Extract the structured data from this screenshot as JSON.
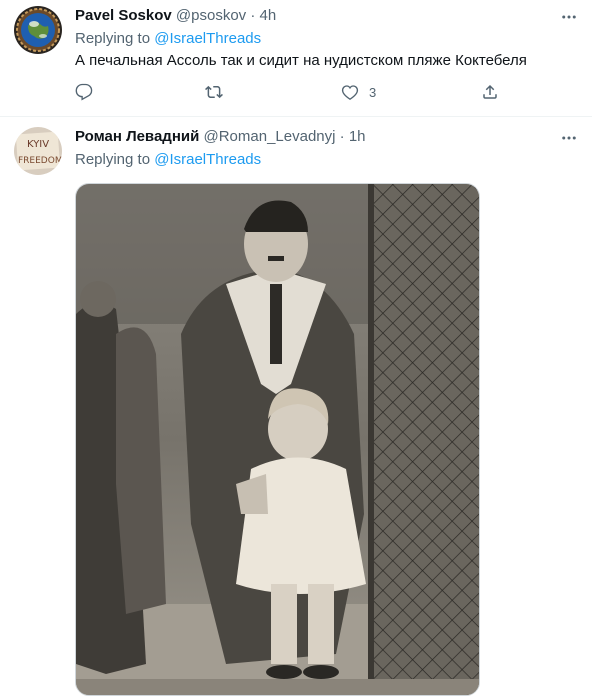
{
  "tweets": [
    {
      "display_name": "Pavel Soskov",
      "handle": "@psoskov",
      "separator": "·",
      "time": "4h",
      "replying_prefix": "Replying to",
      "replying_to": "@IsraelThreads",
      "text": "А печальная Ассоль так и сидит на нудистском пляже Коктебеля",
      "likes": "3",
      "avatar_icon": "globe-avatar-icon"
    },
    {
      "display_name": "Роман Левадний",
      "handle": "@Roman_Levadnyj",
      "separator": "·",
      "time": "1h",
      "replying_prefix": "Replying to",
      "replying_to": "@IsraelThreads",
      "avatar_text_top": "KYIV",
      "avatar_text_bottom": "FREEDOM",
      "media_alt": "sepia photo"
    }
  ],
  "colors": {
    "accent": "#1d9bf0",
    "secondary_text": "#536471",
    "primary_text": "#0f1419",
    "divider": "#eff3f4"
  },
  "icons": [
    "reply-icon",
    "retweet-icon",
    "like-icon",
    "share-icon",
    "more-icon"
  ]
}
